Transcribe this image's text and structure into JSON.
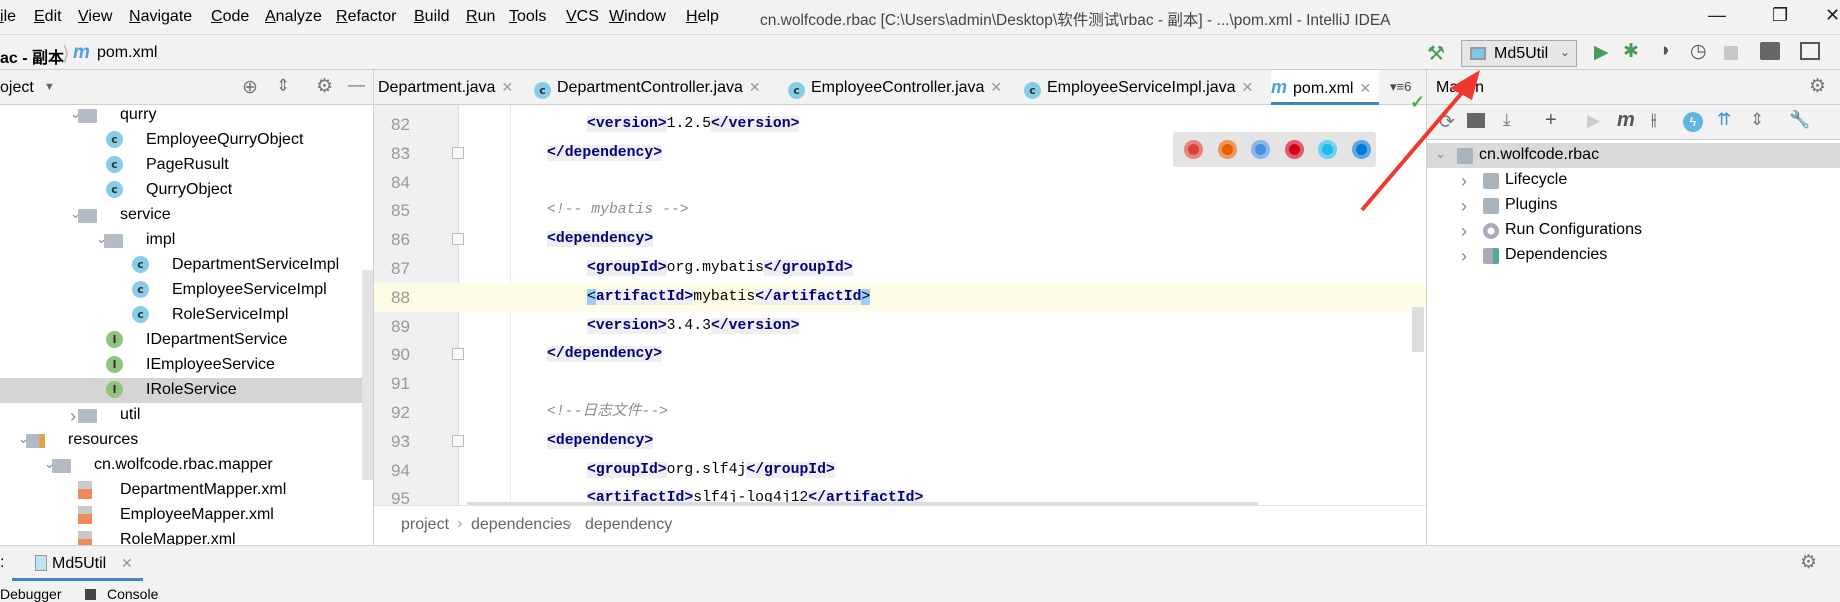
{
  "menu": [
    "ile",
    "Edit",
    "View",
    "Navigate",
    "Code",
    "Analyze",
    "Refactor",
    "Build",
    "Run",
    "Tools",
    "VCS",
    "Window",
    "Help"
  ],
  "window_title": "cn.wolfcode.rbac [C:\\Users\\admin\\Desktop\\软件测试\\rbac - 副本] - ...\\pom.xml - IntelliJ IDEA",
  "breadcrumb": {
    "project": "ac - 副本",
    "file": "pom.xml"
  },
  "run_config": "Md5Util",
  "project_panel": {
    "title": "oject",
    "tree": [
      {
        "label": "qurry",
        "depth": 2,
        "icon": "folder",
        "expanded": true
      },
      {
        "label": "EmployeeQurryObject",
        "depth": 3,
        "icon": "class"
      },
      {
        "label": "PageRusult",
        "depth": 3,
        "icon": "class"
      },
      {
        "label": "QurryObject",
        "depth": 3,
        "icon": "class"
      },
      {
        "label": "service",
        "depth": 2,
        "icon": "folder",
        "expanded": true
      },
      {
        "label": "impl",
        "depth": 3,
        "icon": "folder",
        "expanded": true
      },
      {
        "label": "DepartmentServiceImpl",
        "depth": 4,
        "icon": "class"
      },
      {
        "label": "EmployeeServiceImpl",
        "depth": 4,
        "icon": "class"
      },
      {
        "label": "RoleServiceImpl",
        "depth": 4,
        "icon": "class"
      },
      {
        "label": "IDepartmentService",
        "depth": 3,
        "icon": "interface"
      },
      {
        "label": "IEmployeeService",
        "depth": 3,
        "icon": "interface"
      },
      {
        "label": "IRoleService",
        "depth": 3,
        "icon": "interface",
        "selected": true
      },
      {
        "label": "util",
        "depth": 2,
        "icon": "folder",
        "expanded": false
      },
      {
        "label": "resources",
        "depth": 0,
        "icon": "resources-folder",
        "expanded": true
      },
      {
        "label": "cn.wolfcode.rbac.mapper",
        "depth": 1,
        "icon": "package",
        "expanded": true
      },
      {
        "label": "DepartmentMapper.xml",
        "depth": 2,
        "icon": "xml"
      },
      {
        "label": "EmployeeMapper.xml",
        "depth": 2,
        "icon": "xml"
      },
      {
        "label": "RoleMapper.xml",
        "depth": 2,
        "icon": "xml"
      }
    ]
  },
  "editor": {
    "tabs": [
      {
        "label": "Department.java",
        "icon": "none"
      },
      {
        "label": "DepartmentController.java",
        "icon": "class"
      },
      {
        "label": "EmployeeController.java",
        "icon": "class"
      },
      {
        "label": "EmployeeServiceImpl.java",
        "icon": "class"
      },
      {
        "label": "pom.xml",
        "icon": "maven",
        "active": true
      }
    ],
    "tab_overflow": "6",
    "current_line": 88,
    "lines": [
      {
        "n": 82,
        "indent": 3,
        "parts": [
          [
            "tag",
            "<version>"
          ],
          [
            "txt",
            "1.2.5"
          ],
          [
            "tag",
            "</version>"
          ]
        ]
      },
      {
        "n": 83,
        "indent": 2,
        "parts": [
          [
            "tag",
            "</dependency>"
          ]
        ]
      },
      {
        "n": 84,
        "indent": 0,
        "parts": []
      },
      {
        "n": 85,
        "indent": 2,
        "parts": [
          [
            "cmt",
            "<!-- mybatis -->"
          ]
        ]
      },
      {
        "n": 86,
        "indent": 2,
        "parts": [
          [
            "tag",
            "<dependency>"
          ]
        ]
      },
      {
        "n": 87,
        "indent": 3,
        "parts": [
          [
            "tag",
            "<groupId>"
          ],
          [
            "txt",
            "org.mybatis"
          ],
          [
            "tag",
            "</groupId>"
          ]
        ]
      },
      {
        "n": 88,
        "indent": 3,
        "parts": [
          [
            "bm",
            "<"
          ],
          [
            "tag",
            "artifactId>"
          ],
          [
            "txt",
            "mybatis"
          ],
          [
            "tag",
            "</artifactId"
          ],
          [
            "bm",
            ">"
          ]
        ]
      },
      {
        "n": 89,
        "indent": 3,
        "parts": [
          [
            "tag",
            "<version>"
          ],
          [
            "txt",
            "3.4.3"
          ],
          [
            "tag",
            "</version>"
          ]
        ]
      },
      {
        "n": 90,
        "indent": 2,
        "parts": [
          [
            "tag",
            "</dependency>"
          ]
        ]
      },
      {
        "n": 91,
        "indent": 0,
        "parts": []
      },
      {
        "n": 92,
        "indent": 2,
        "parts": [
          [
            "cmt",
            "<!--日志文件-->"
          ]
        ]
      },
      {
        "n": 93,
        "indent": 2,
        "parts": [
          [
            "tag",
            "<dependency>"
          ]
        ]
      },
      {
        "n": 94,
        "indent": 3,
        "parts": [
          [
            "tag",
            "<groupId>"
          ],
          [
            "txt",
            "org.slf4j"
          ],
          [
            "tag",
            "</groupId>"
          ]
        ]
      },
      {
        "n": 95,
        "indent": 3,
        "parts": [
          [
            "tag",
            "<artifactId>"
          ],
          [
            "txt",
            "slf4j-log4j12"
          ],
          [
            "tag",
            "</artifactId>"
          ]
        ]
      }
    ],
    "crumbs": [
      "project",
      "dependencies",
      "dependency"
    ],
    "browsers": [
      "chrome",
      "firefox",
      "safari",
      "opera",
      "internet-explorer",
      "edge"
    ]
  },
  "maven": {
    "title": "Maven",
    "tree": [
      {
        "label": "cn.wolfcode.rbac",
        "icon": "maven-module",
        "expanded": true,
        "selected": true
      },
      {
        "label": "Lifecycle",
        "icon": "folder-gear"
      },
      {
        "label": "Plugins",
        "icon": "folder-gear"
      },
      {
        "label": "Run Configurations",
        "icon": "gear"
      },
      {
        "label": "Dependencies",
        "icon": "dependencies"
      }
    ]
  },
  "bottom": {
    "tab": "Md5Util",
    "tools": [
      "Debugger",
      "Console"
    ]
  },
  "colors": {
    "accent": "#4083c9",
    "run_green": "#499c54",
    "arrow_red": "#f2372f",
    "tag": "#000080"
  }
}
